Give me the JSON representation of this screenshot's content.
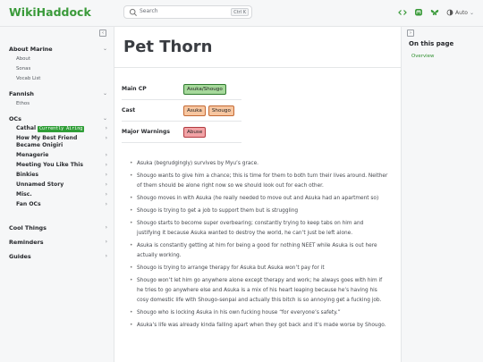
{
  "brand": "WikiHaddock",
  "search": {
    "placeholder": "Search",
    "shortcut": "Ctrl K"
  },
  "toolbar": {
    "theme_label": "Auto",
    "colors": {
      "accent": "#3a9a3a"
    }
  },
  "sidebar": {
    "sections": [
      {
        "label": "About Marine",
        "items": [
          "About",
          "Sonas",
          "Vocab List"
        ]
      },
      {
        "label": "Fannish",
        "items": [
          "Ethos"
        ]
      }
    ],
    "ocs": {
      "label": "OCs",
      "items": [
        {
          "label": "Cathal",
          "badge": "Currently Airing"
        },
        {
          "label": "How My Best Friend Became Onigiri"
        },
        {
          "label": "Menagerie"
        },
        {
          "label": "Meeting You Like This"
        },
        {
          "label": "Binkies"
        },
        {
          "label": "Unnamed Story"
        },
        {
          "label": "Misc."
        },
        {
          "label": "Fan OCs"
        }
      ]
    },
    "bottom": [
      "Cool Things",
      "Reminders",
      "Guides"
    ]
  },
  "toc": {
    "title": "On this page",
    "items": [
      "Overview"
    ]
  },
  "page": {
    "title": "Pet Thorn",
    "properties": [
      {
        "label": "Main CP",
        "tags": [
          {
            "text": "Asuka/Shougo",
            "color": "green"
          }
        ]
      },
      {
        "label": "Cast",
        "tags": [
          {
            "text": "Asuka",
            "color": "orange"
          },
          {
            "text": "Shougo",
            "color": "orange"
          }
        ]
      },
      {
        "label": "Major Warnings",
        "tags": [
          {
            "text": "Abuse",
            "color": "red"
          }
        ]
      }
    ],
    "bullets": [
      "Asuka (begrudgingly) survives by Myu’s grace.",
      "Shougo wants to give him a chance; this is time for them to both turn their lives around. Neither of them should be alone right now so we should look out for each other.",
      "Shougo moves in with Asuka (he really needed to move out and Asuka had an apartment so)",
      "Shougo is trying to get a job to support them but is struggling",
      "Shougo starts to become super overbearing; constantly trying to keep tabs on him and justifying it because Asuka wanted to destroy the world, he can’t just be left alone.",
      "Asuka is constantly getting at him for being a good for nothing NEET while Asuka is out here actually working.",
      "Shougo is trying to arrange therapy for Asuka but Asuka won’t pay for it",
      "Shougo won’t let him go anywhere alone except therapy and work; he always goes with him if he tries to go anywhere else and Asuka is a mix of his heart leaping because he’s having his cosy domestic life with Shougo-senpai and actually this bitch is so annoying get a fucking job.",
      "Shougo who is locking Asuka in his own fucking house “for everyone’s safety.”",
      "Asuka’s life was already kinda falling apart when they got back and it’s made worse by Shougo."
    ]
  }
}
